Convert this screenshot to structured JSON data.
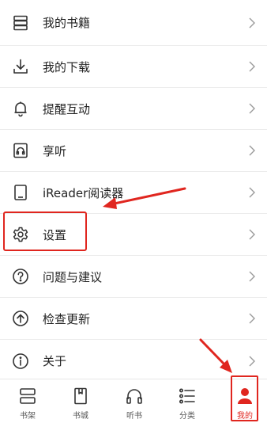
{
  "menu": {
    "items": [
      {
        "label": "我的书籍",
        "icon": "bookshelf-icon"
      },
      {
        "label": "我的下载",
        "icon": "download-icon"
      },
      {
        "label": "提醒互动",
        "icon": "bell-icon"
      },
      {
        "label": "享听",
        "icon": "headphones-book-icon"
      },
      {
        "label": "iReader阅读器",
        "icon": "ereader-device-icon"
      },
      {
        "label": "设置",
        "icon": "gear-icon"
      },
      {
        "label": "问题与建议",
        "icon": "help-icon"
      },
      {
        "label": "检查更新",
        "icon": "update-arrow-icon"
      },
      {
        "label": "关于",
        "icon": "info-icon"
      }
    ]
  },
  "tabbar": {
    "items": [
      {
        "label": "书架",
        "icon": "bookshelf-tab-icon"
      },
      {
        "label": "书城",
        "icon": "bookstore-tab-icon"
      },
      {
        "label": "听书",
        "icon": "headphones-tab-icon"
      },
      {
        "label": "分类",
        "icon": "category-list-icon"
      },
      {
        "label": "我的",
        "icon": "profile-person-icon",
        "active": true
      }
    ]
  },
  "colors": {
    "accent": "#e0261f",
    "text": "#222222",
    "divider": "#ececec",
    "icon": "#333333"
  }
}
